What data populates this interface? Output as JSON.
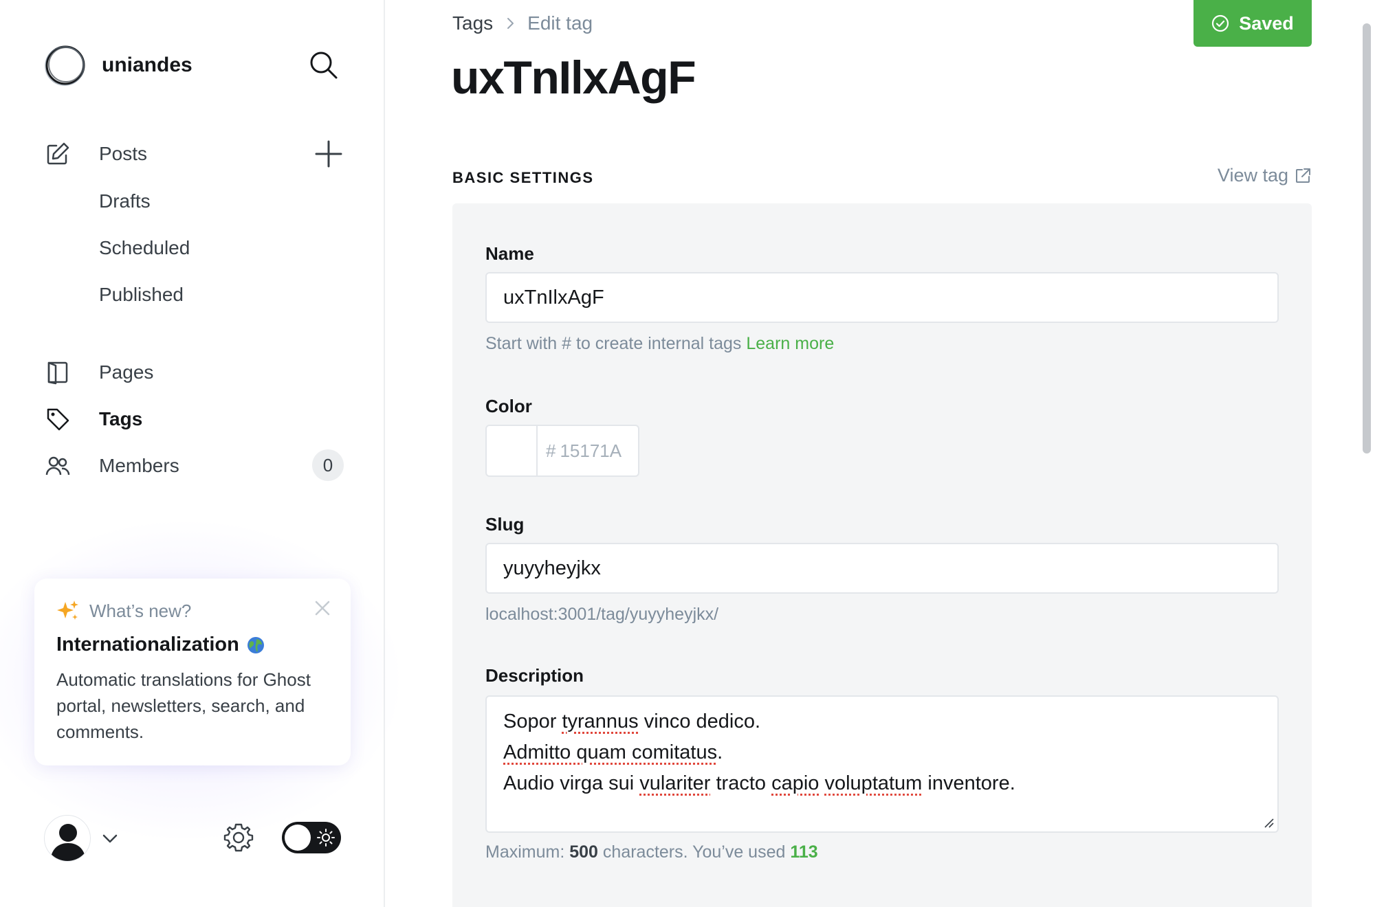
{
  "app": {
    "site_name": "uniandes"
  },
  "sidebar": {
    "posts": {
      "label": "Posts"
    },
    "post_subitems": [
      {
        "label": "Drafts"
      },
      {
        "label": "Scheduled"
      },
      {
        "label": "Published"
      }
    ],
    "pages": {
      "label": "Pages"
    },
    "tags": {
      "label": "Tags",
      "active": true
    },
    "members": {
      "label": "Members",
      "count": "0"
    },
    "icons": [
      "brand-logo-icon",
      "search-icon",
      "pencil-icon",
      "plus-icon",
      "pages-icon",
      "tag-icon",
      "members-icon",
      "avatar-icon",
      "chevron-down-icon",
      "gear-icon",
      "sun-icon"
    ]
  },
  "whats_new": {
    "kicker": "What’s new?",
    "title": "Internationalization",
    "body": "Automatic translations for Ghost portal, newsletters, search, and comments."
  },
  "header": {
    "breadcrumb_root": "Tags",
    "breadcrumb_current": "Edit tag",
    "page_title": "uxTnIlxAgF",
    "saved_label": "Saved"
  },
  "settings": {
    "section_label": "BASIC SETTINGS",
    "view_tag_label": "View tag",
    "name": {
      "label": "Name",
      "value": "uxTnIlxAgF",
      "hint": "Start with # to create internal tags",
      "hint_link": "Learn more"
    },
    "color": {
      "label": "Color",
      "hash": "#",
      "placeholder": "15171A"
    },
    "slug": {
      "label": "Slug",
      "value": "yuyyheyjkx",
      "url": "localhost:3001/tag/yuyyheyjkx/"
    },
    "description": {
      "label": "Description",
      "lines": [
        [
          "Sopor ",
          "tyrannus",
          " vinco dedico."
        ],
        [
          "Admitto quam comitatus",
          "",
          "."
        ],
        [
          "Audio virga sui ",
          "vulariter",
          " tracto ",
          "capio",
          " ",
          "voluptatum",
          " inventore."
        ]
      ],
      "counter_prefix": "Maximum:",
      "max": "500",
      "counter_middle": "characters. You’ve used",
      "used": "113"
    }
  },
  "colors": {
    "accent_green": "#4ab048",
    "text_dark": "#15171a",
    "text_muted": "#7c8b9a",
    "panel_bg": "#f4f5f6"
  }
}
